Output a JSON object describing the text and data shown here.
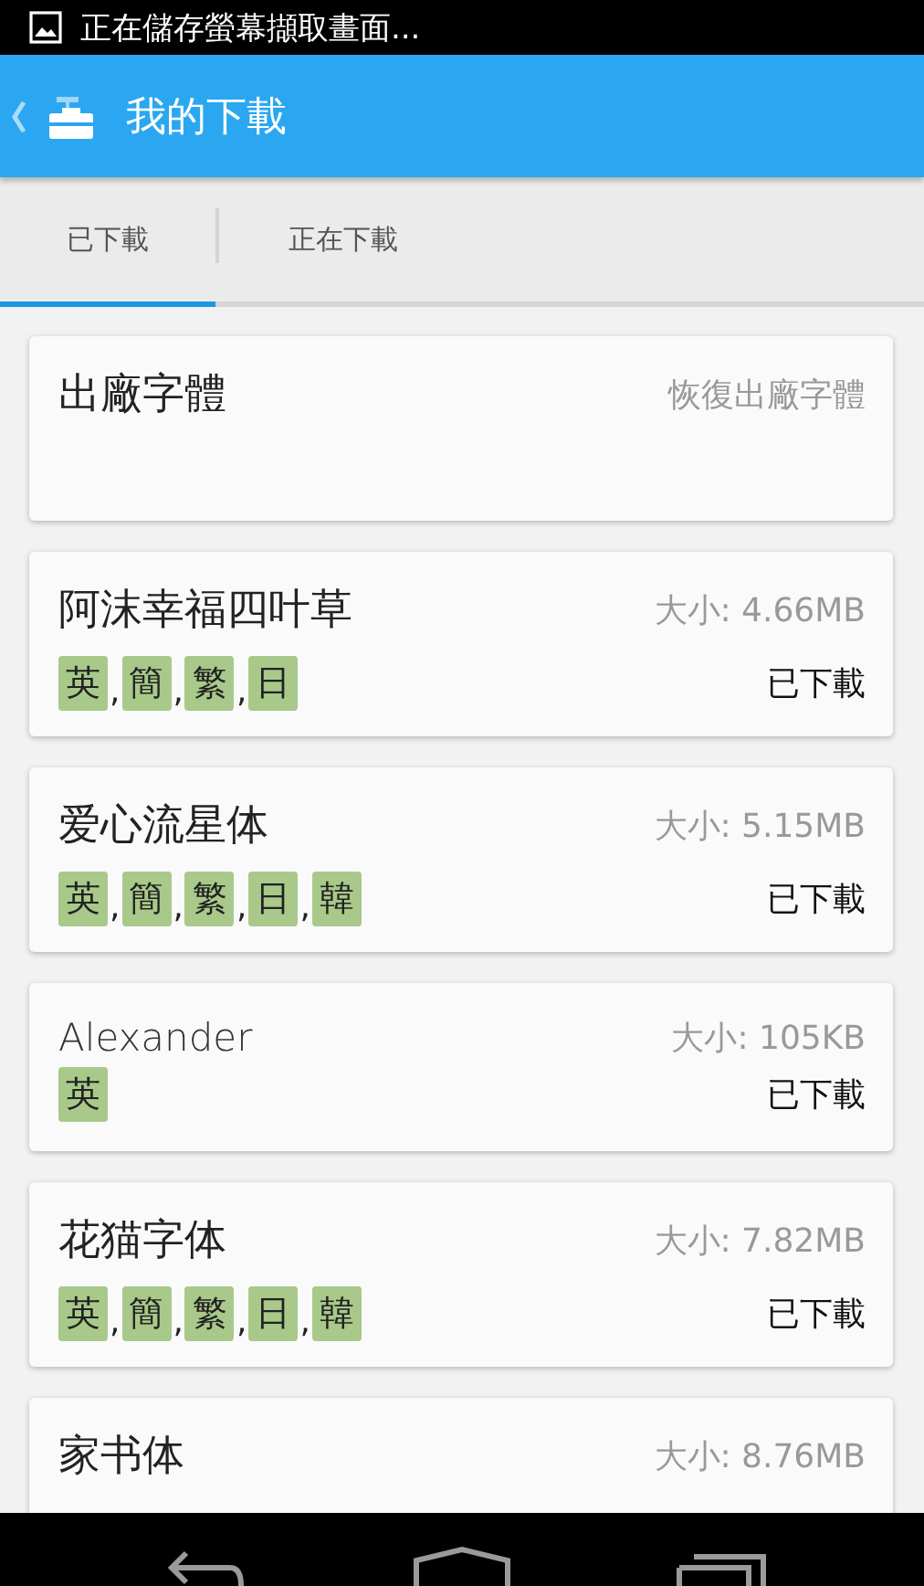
{
  "status_bar": {
    "notification": "正在儲存螢幕擷取畫面..."
  },
  "app_bar": {
    "title": "我的下載"
  },
  "tabs": [
    {
      "label": "已下載",
      "selected": true
    },
    {
      "label": "正在下載",
      "selected": false
    }
  ],
  "fonts": [
    {
      "kind": "default",
      "name": "出廠字體",
      "action": "恢復出廠字體"
    },
    {
      "kind": "font",
      "name": "阿沫幸福四叶草",
      "size": "大小: 4.66MB",
      "tags": [
        {
          "label": "英",
          "separator": ","
        },
        {
          "label": "簡",
          "separator": ","
        },
        {
          "label": "繁",
          "separator": ","
        },
        {
          "label": "日"
        }
      ],
      "status": "已下載"
    },
    {
      "kind": "font",
      "name": "爱心流星体",
      "size": "大小: 5.15MB",
      "tags": [
        {
          "label": "英",
          "separator": ","
        },
        {
          "label": "簡",
          "separator": ","
        },
        {
          "label": "繁",
          "separator": ","
        },
        {
          "label": "日",
          "separator": ","
        },
        {
          "label": "韓"
        }
      ],
      "status": "已下載"
    },
    {
      "kind": "font",
      "name": "Alexander",
      "size": "大小: 105KB",
      "tags": [
        {
          "label": "英"
        }
      ],
      "status": "已下載",
      "compact": true
    },
    {
      "kind": "font",
      "name": "花猫字体",
      "size": "大小: 7.82MB",
      "tags": [
        {
          "label": "英",
          "separator": ","
        },
        {
          "label": "簡",
          "separator": ","
        },
        {
          "label": "繁",
          "separator": ","
        },
        {
          "label": "日",
          "separator": ","
        },
        {
          "label": "韓"
        }
      ],
      "status": "已下載"
    },
    {
      "kind": "font",
      "name": "家书体",
      "size": "大小: 8.76MB"
    }
  ]
}
